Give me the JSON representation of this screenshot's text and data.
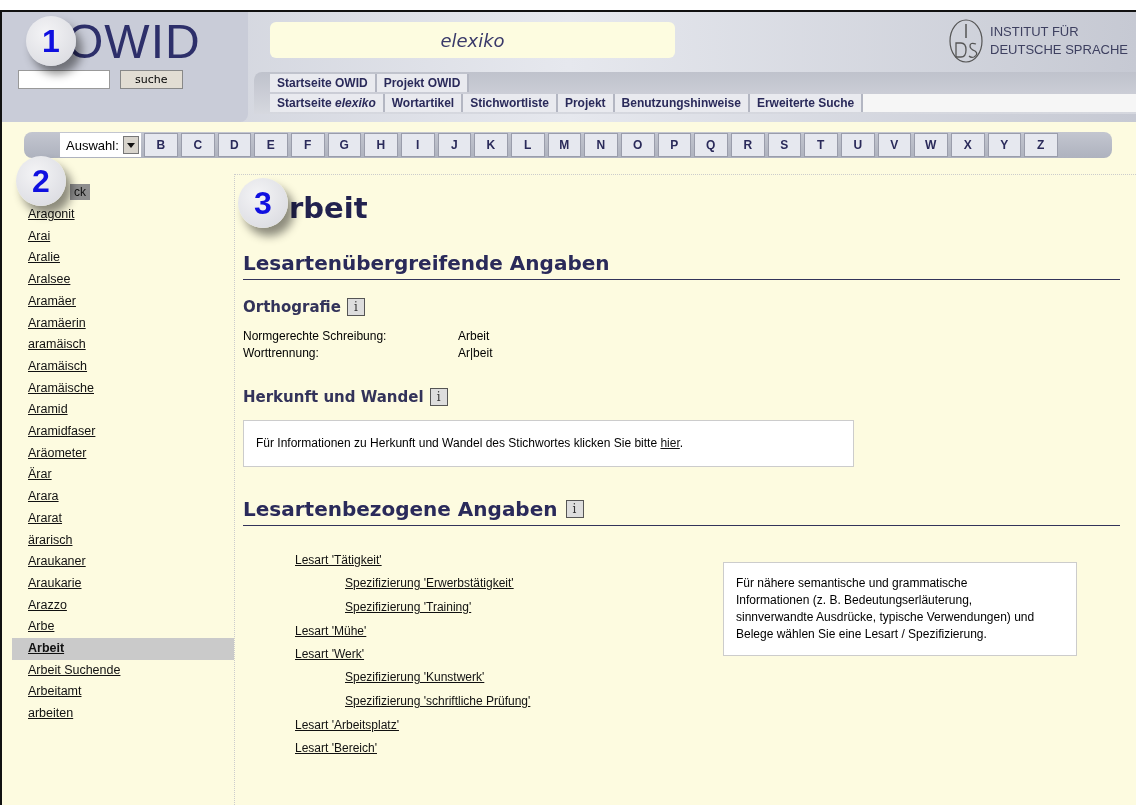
{
  "header": {
    "logo": "OWID",
    "search": {
      "button": "suche"
    },
    "title": "elexiko",
    "institute": [
      "INSTITUT FÜR",
      "DEUTSCHE SPRACHE"
    ]
  },
  "nav_rows": [
    [
      {
        "label": "Startseite OWID"
      },
      {
        "label": "Projekt OWID"
      }
    ],
    [
      {
        "label": "Startseite *elexiko*"
      },
      {
        "label": "Wortartikel"
      },
      {
        "label": "Stichwortliste"
      },
      {
        "label": "Projekt"
      },
      {
        "label": "Benutzungshinweise"
      },
      {
        "label": "Erweiterte Suche"
      }
    ]
  ],
  "alphabet": {
    "label": "Auswahl:",
    "letters": [
      "B",
      "C",
      "D",
      "E",
      "F",
      "G",
      "H",
      "I",
      "J",
      "K",
      "L",
      "M",
      "N",
      "O",
      "P",
      "Q",
      "R",
      "S",
      "T",
      "U",
      "V",
      "W",
      "X",
      "Y",
      "Z"
    ]
  },
  "callouts": [
    "1",
    "2",
    "3"
  ],
  "sidebar": {
    "back_button": "ck",
    "items": [
      {
        "label": "Aragonit",
        "selected": false
      },
      {
        "label": "Arai",
        "selected": false
      },
      {
        "label": "Aralie",
        "selected": false
      },
      {
        "label": "Aralsee",
        "selected": false
      },
      {
        "label": "Aramäer",
        "selected": false
      },
      {
        "label": "Aramäerin",
        "selected": false
      },
      {
        "label": "aramäisch",
        "selected": false
      },
      {
        "label": "Aramäisch",
        "selected": false
      },
      {
        "label": "Aramäische",
        "selected": false
      },
      {
        "label": "Aramid",
        "selected": false
      },
      {
        "label": "Aramidfaser",
        "selected": false
      },
      {
        "label": "Aräometer",
        "selected": false
      },
      {
        "label": "Ärar",
        "selected": false
      },
      {
        "label": "Arara",
        "selected": false
      },
      {
        "label": "Ararat",
        "selected": false
      },
      {
        "label": "ärarisch",
        "selected": false
      },
      {
        "label": "Araukaner",
        "selected": false
      },
      {
        "label": "Araukarie",
        "selected": false
      },
      {
        "label": "Arazzo",
        "selected": false
      },
      {
        "label": "Arbe",
        "selected": false
      },
      {
        "label": "Arbeit",
        "selected": true
      },
      {
        "label": "Arbeit Suchende",
        "selected": false
      },
      {
        "label": "Arbeitamt",
        "selected": false
      },
      {
        "label": "arbeiten",
        "selected": false
      }
    ]
  },
  "article": {
    "title": "rbeit",
    "section_general": "Lesartenübergreifende Angaben",
    "orthography": {
      "heading": "Orthografie",
      "info": "i",
      "rows": [
        {
          "label": "Normgerechte Schreibung:",
          "value": "Arbeit"
        },
        {
          "label": "Worttrennung:",
          "value": "Ar|beit"
        }
      ]
    },
    "origin": {
      "heading": "Herkunft und Wandel",
      "info": "i",
      "text": "Für Informationen zu Herkunft und Wandel des Stichwortes klicken Sie bitte",
      "link": "hier",
      "after": "."
    },
    "section_readings": {
      "heading": "Lesartenbezogene Angaben",
      "info": "i"
    },
    "readings": [
      {
        "label": "Lesart 'Tätigkeit'",
        "children": [
          {
            "label": "Spezifizierung 'Erwerbstätigkeit'"
          },
          {
            "label": "Spezifizierung 'Training'"
          }
        ]
      },
      {
        "label": "Lesart 'Mühe'"
      },
      {
        "label": "Lesart 'Werk'",
        "children": [
          {
            "label": "Spezifizierung 'Kunstwerk'"
          },
          {
            "label": "Spezifizierung 'schriftliche Prüfung'"
          }
        ]
      },
      {
        "label": "Lesart 'Arbeitsplatz'"
      },
      {
        "label": "Lesart 'Bereich'"
      }
    ],
    "hint": "Für nähere semantische und grammatische Informationen (z. B. Bedeutungserläuterung, sinnverwandte Ausdrücke, typische Verwendungen) und Belege wählen Sie eine Lesart / Spezifizierung."
  }
}
